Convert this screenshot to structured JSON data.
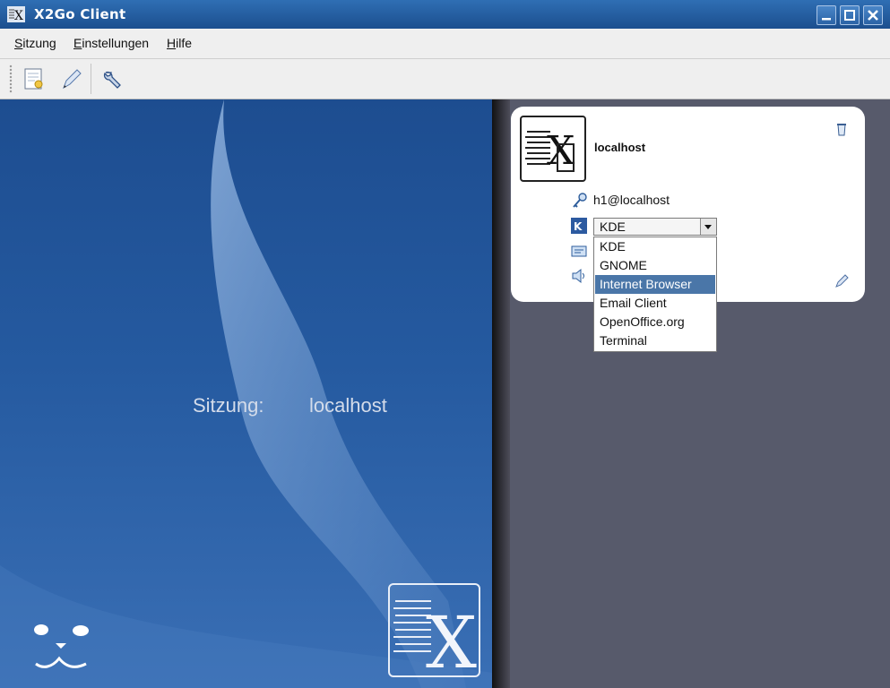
{
  "window": {
    "title": "X2Go Client"
  },
  "menu": {
    "items": [
      {
        "label": "Sitzung"
      },
      {
        "label": "Einstellungen"
      },
      {
        "label": "Hilfe"
      }
    ]
  },
  "toolbar": {
    "buttons": [
      {
        "icon": "new-session-icon"
      },
      {
        "icon": "edit-session-icon"
      },
      {
        "icon": "settings-icon"
      }
    ]
  },
  "left": {
    "session_label": "Sitzung:",
    "session_value": "localhost"
  },
  "session_card": {
    "title": "localhost",
    "user": "h1@localhost",
    "session_type": {
      "selected": "KDE",
      "options": [
        "KDE",
        "GNOME",
        "Internet Browser",
        "Email Client",
        "OpenOffice.org",
        "Terminal"
      ],
      "highlighted": "Internet Browser"
    }
  },
  "colors": {
    "accent": "#4a76a8",
    "titlebar": "#2f6fb4",
    "left_bg": "#255aa0",
    "right_bg": "#575a6b"
  }
}
